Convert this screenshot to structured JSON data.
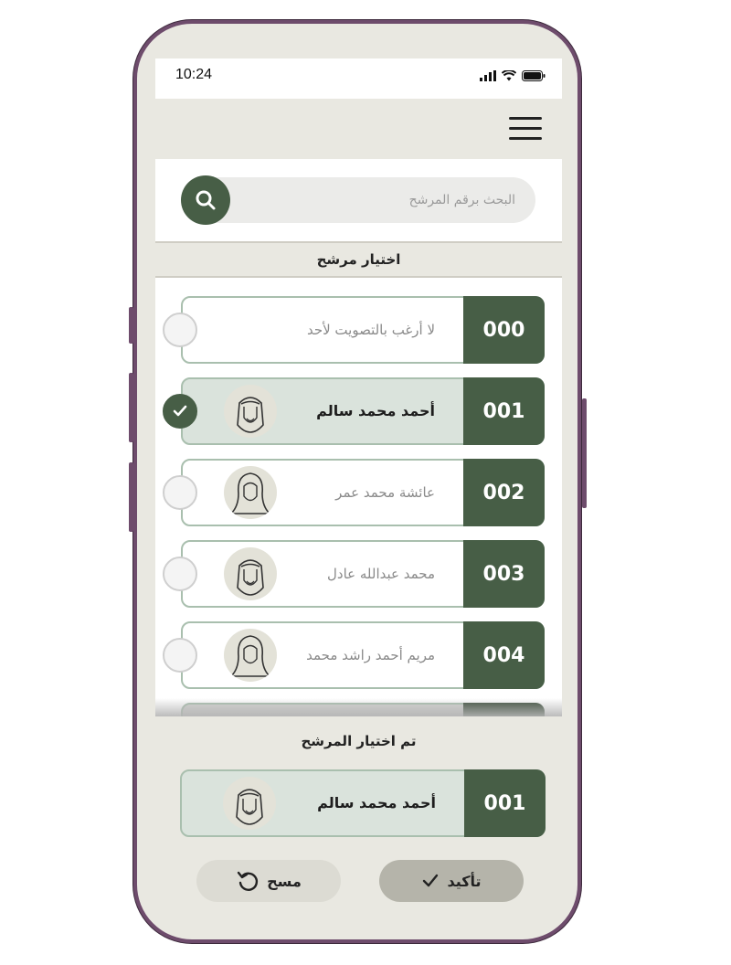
{
  "status": {
    "time": "10:24"
  },
  "search": {
    "placeholder": "البحث برقم المرشح"
  },
  "section_title": "اختيار مرشح",
  "candidates": [
    {
      "number": "000",
      "name": "لا أرغب بالتصويت لأحد",
      "selected": false,
      "avatar": "none"
    },
    {
      "number": "001",
      "name": "أحمد محمد سالم",
      "selected": true,
      "avatar": "male"
    },
    {
      "number": "002",
      "name": "عائشة محمد عمر",
      "selected": false,
      "avatar": "female"
    },
    {
      "number": "003",
      "name": "محمد عبدالله عادل",
      "selected": false,
      "avatar": "male"
    },
    {
      "number": "004",
      "name": "مريم أحمد راشد محمد",
      "selected": false,
      "avatar": "female"
    }
  ],
  "selected_section": {
    "title": "تم اختيار المرشح",
    "number": "001",
    "name": "أحمد محمد سالم"
  },
  "buttons": {
    "confirm": "تأكيد",
    "clear": "مسح"
  },
  "colors": {
    "accent": "#475e46",
    "selected_bg": "#dae3dc",
    "frame": "#6e4c6c",
    "app_bg": "#e9e8e1"
  },
  "icons": {
    "menu": "hamburger-icon",
    "search": "search-icon",
    "check": "check-icon",
    "clear": "undo-icon"
  }
}
